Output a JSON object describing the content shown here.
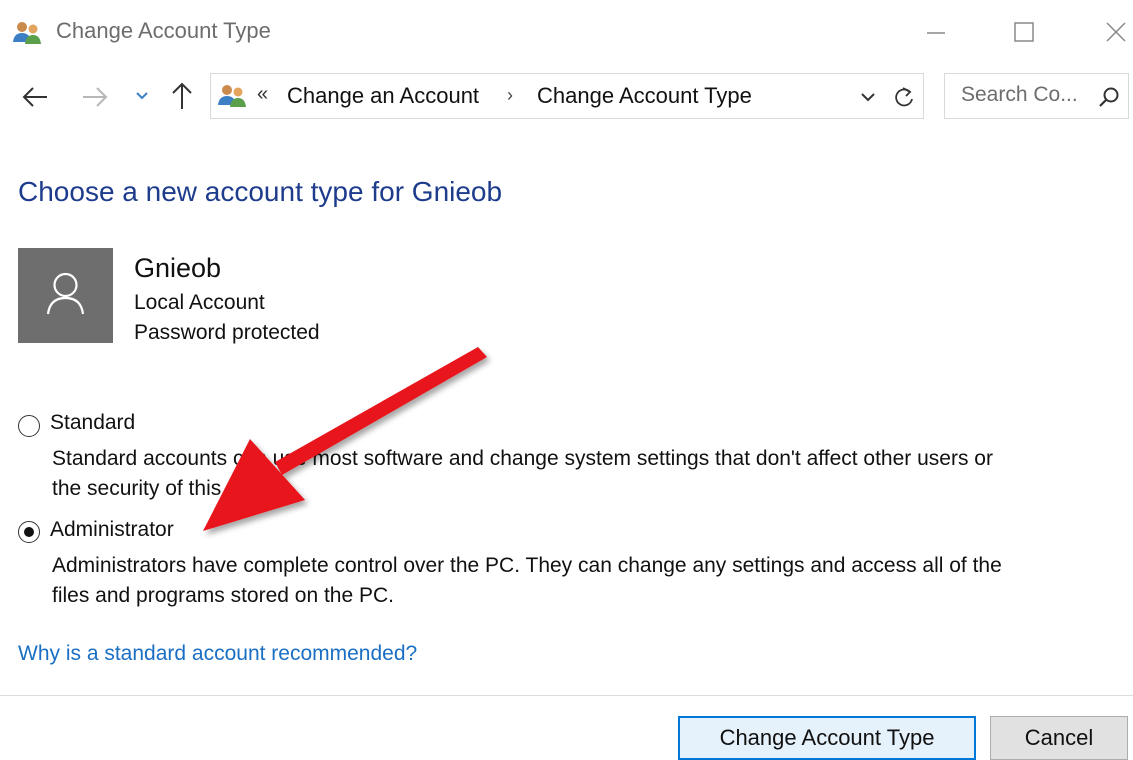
{
  "window": {
    "title": "Change Account Type",
    "controls": {
      "minimize": "minimize",
      "maximize": "maximize",
      "close": "close"
    }
  },
  "nav": {
    "address": {
      "overflow": "«",
      "crumbs": [
        "Change an Account",
        "Change Account Type"
      ],
      "separator": "›"
    },
    "search": {
      "placeholder": "Search Co..."
    }
  },
  "main": {
    "heading": "Choose a new account type for Gnieob",
    "user": {
      "name": "Gnieob",
      "account_type": "Local Account",
      "status": "Password protected"
    },
    "options": [
      {
        "label": "Standard",
        "selected": false,
        "desc_line1": "Standard accounts can use most software and change system settings that don't affect other users or",
        "desc_line2": "the security of this PC."
      },
      {
        "label": "Administrator",
        "selected": true,
        "desc_line1": "Administrators have complete control over the PC. They can change any settings and access all of the",
        "desc_line2": "files and programs stored on the PC."
      }
    ],
    "help_link": "Why is a standard account recommended?"
  },
  "footer": {
    "primary_button": "Change Account Type",
    "cancel_button": "Cancel"
  },
  "colors": {
    "heading": "#1e3c8c",
    "link": "#1a6fc4",
    "avatar_bg": "#6e6e6e",
    "primary_border": "#0078d7",
    "annotation_arrow": "#e8141b"
  },
  "icons": {
    "app": "users-icon",
    "back": "back-arrow-icon",
    "forward": "forward-arrow-icon",
    "recent": "chevron-down-icon",
    "up": "up-arrow-icon",
    "refresh": "refresh-icon",
    "search": "search-icon",
    "avatar": "user-icon"
  }
}
